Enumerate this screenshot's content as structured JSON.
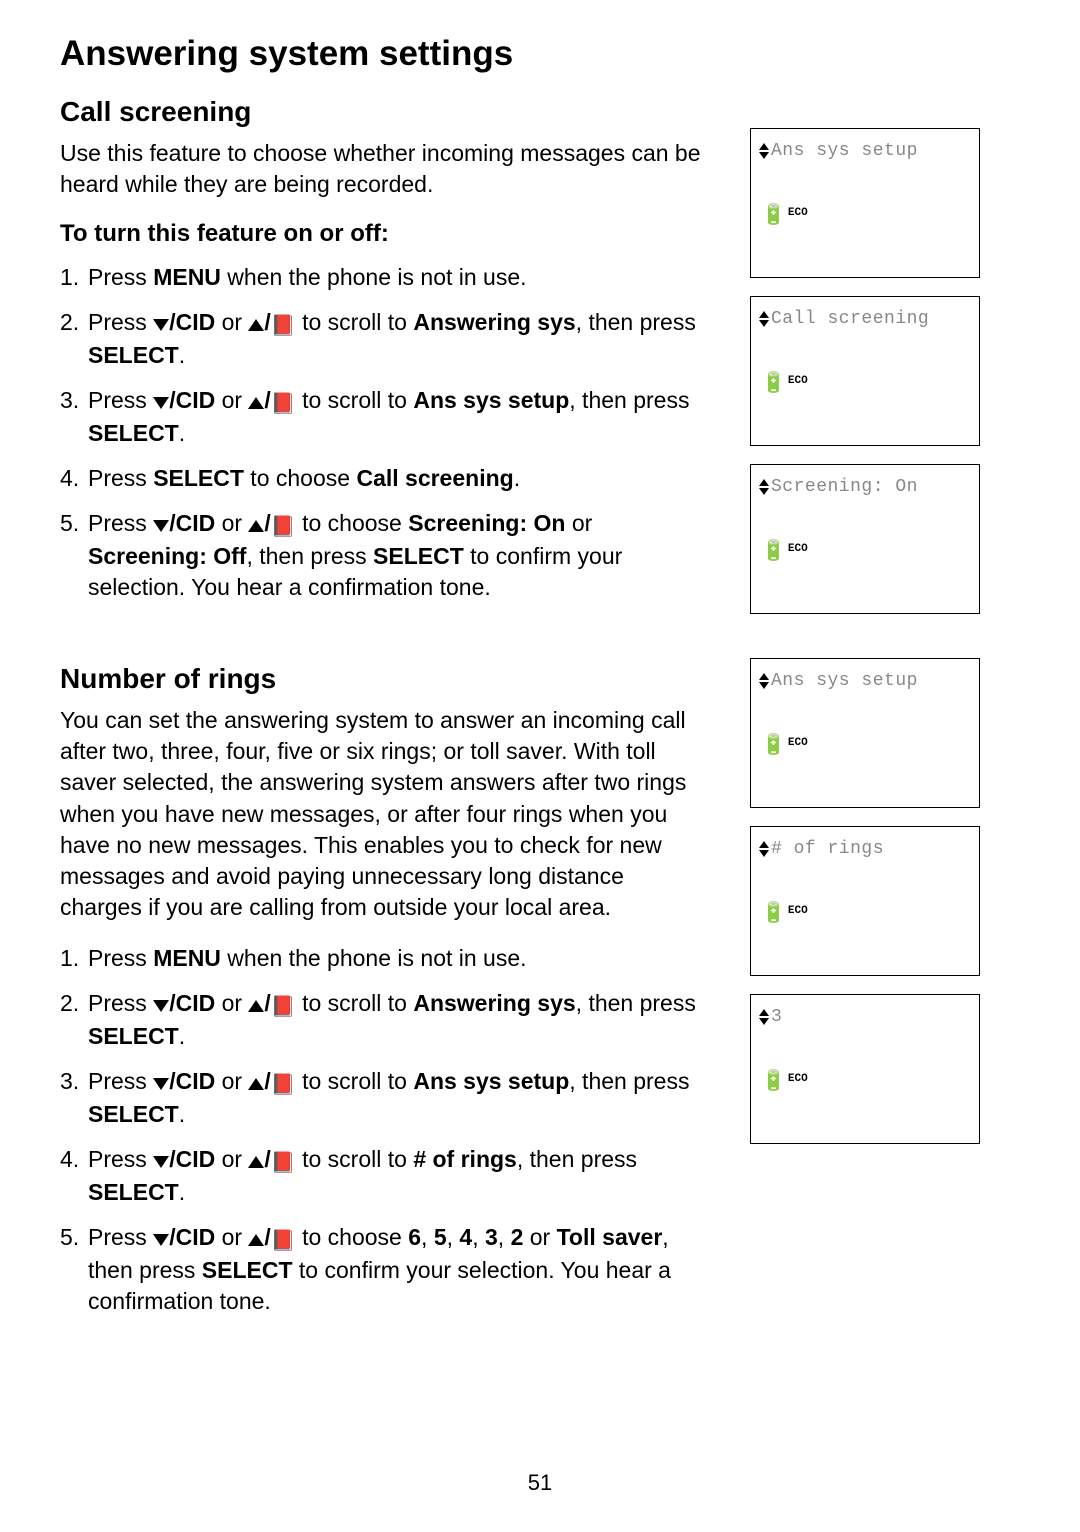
{
  "title": "Answering system settings",
  "section1": {
    "heading": "Call screening",
    "intro": "Use this feature to choose whether incoming messages can be heard while they are being recorded.",
    "sub": "To turn this feature on or off:",
    "steps": {
      "s1_pre": "Press ",
      "menu": "MENU",
      "s1_post": " when the phone is not in use.",
      "cid": "/CID",
      "scroll_to": " to scroll to ",
      "answering_sys": "Answering sys",
      "then_press": ", then press ",
      "select": "SELECT",
      "ans_sys_setup": "Ans sys setup",
      "s4_pre": "Press ",
      "s4_mid": " to choose ",
      "call_screening": "Call screening",
      "choose": " to choose ",
      "screening_on": "Screening: On",
      "s5_or": " or ",
      "screening_off": "Screening: Off",
      "s5_then": ", then press ",
      "s5_post": " to confirm your selection. You hear a confirmation tone."
    }
  },
  "section2": {
    "heading": "Number of rings",
    "intro": "You can set the answering system to answer an incoming call after two, three, four, five or six rings; or toll saver. With toll saver selected, the answering system answers after two rings when you have new messages, or after four rings when you have no new messages. This enables you to check for new messages and avoid paying unnecessary long distance charges if you are calling from outside your local area.",
    "steps": {
      "of_rings": "# of rings",
      "options": "6",
      "c5": "5",
      "c4": "4",
      "c3": "3",
      "c2": "2",
      "toll": "Toll saver",
      "comma": ", ",
      "s5_then": ", then press ",
      "s5_post": " to confirm your selection. You hear a confirmation tone.",
      "period": "."
    }
  },
  "lcd": {
    "ans_sys_setup": "Ans sys setup",
    "call_screening": "Call screening",
    "screening_on": "Screening: On",
    "num_rings": "# of rings",
    "three": "3",
    "eco": "ECO"
  },
  "common": {
    "press": "Press ",
    "or": " or ",
    "slash": "/"
  },
  "page_number": "51"
}
